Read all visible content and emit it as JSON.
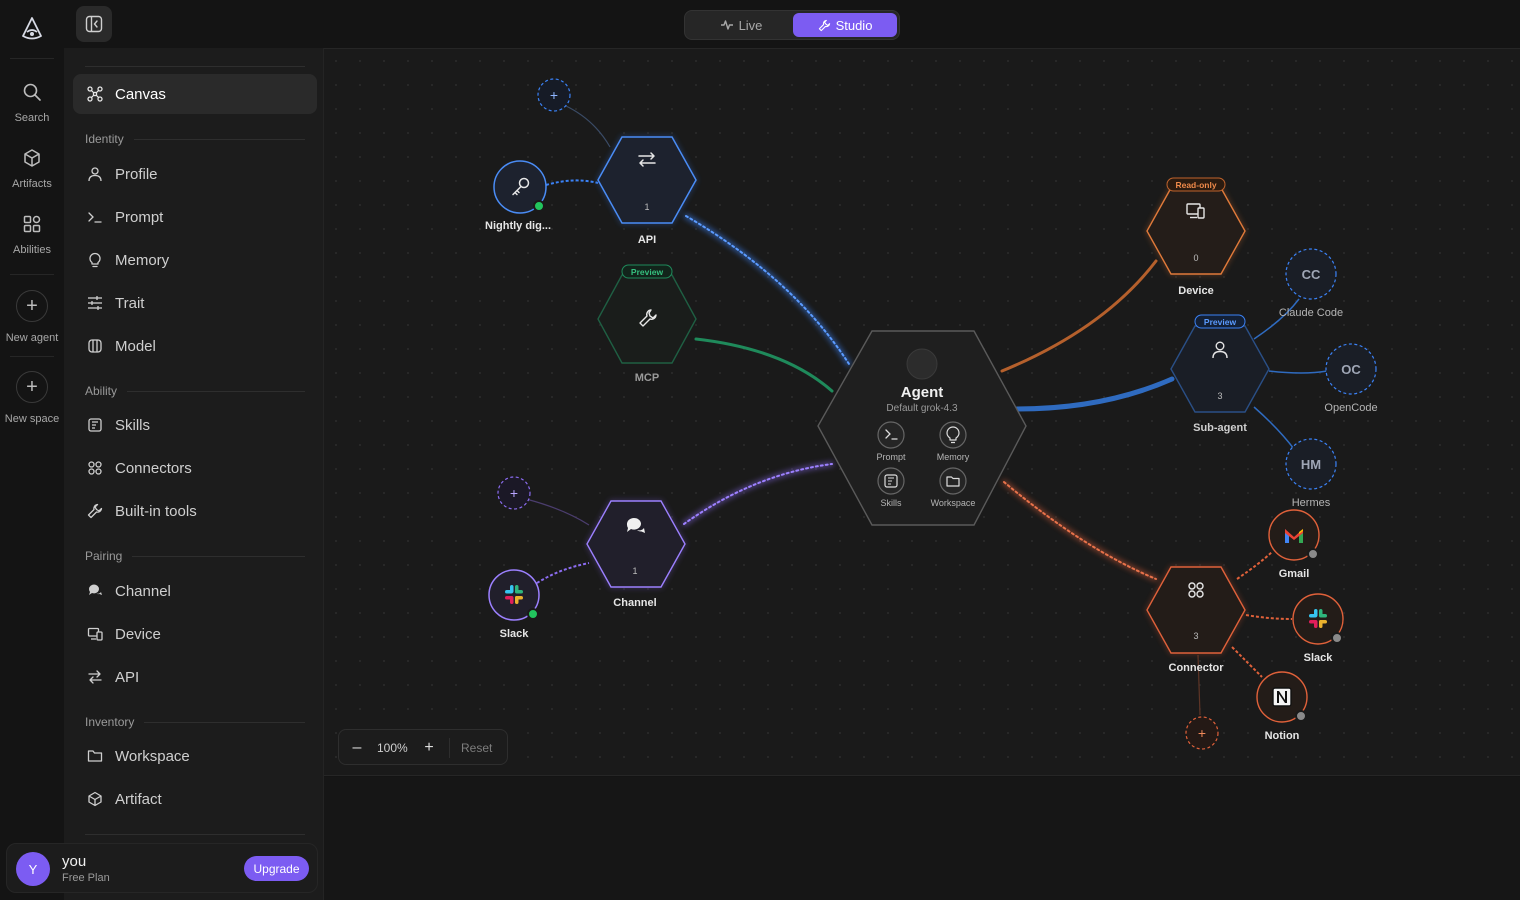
{
  "rail": {
    "items": [
      {
        "label": "Search",
        "icon": "search-icon"
      },
      {
        "label": "Artifacts",
        "icon": "cube-icon"
      },
      {
        "label": "Abilities",
        "icon": "grid-icon"
      },
      {
        "label": "New agent",
        "icon": "plus-icon"
      },
      {
        "label": "New space",
        "icon": "plus-icon"
      }
    ]
  },
  "mode": {
    "live": "Live",
    "studio": "Studio"
  },
  "sidebar": {
    "canvas": "Canvas",
    "sections": {
      "identity": "Identity",
      "ability": "Ability",
      "pairing": "Pairing",
      "inventory": "Inventory"
    },
    "identity": [
      "Profile",
      "Prompt",
      "Memory",
      "Trait",
      "Model"
    ],
    "ability": [
      "Skills",
      "Connectors",
      "Built-in tools"
    ],
    "pairing": [
      "Channel",
      "Device",
      "API"
    ],
    "inventory": [
      "Workspace",
      "Artifact"
    ]
  },
  "user": {
    "initial": "Y",
    "name": "you",
    "plan": "Free Plan",
    "upgrade": "Upgrade"
  },
  "zoom": {
    "minus": "–",
    "value": "100%",
    "plus": "+",
    "reset": "Reset"
  },
  "graph": {
    "agent": {
      "title": "Agent",
      "subtitle": "Default grok-4.3",
      "modules": [
        "Prompt",
        "Memory",
        "Skills",
        "Workspace"
      ]
    },
    "api": {
      "label": "API",
      "count": "1"
    },
    "mcp": {
      "label": "MCP",
      "badge": "Preview"
    },
    "channel": {
      "label": "Channel",
      "count": "1"
    },
    "device": {
      "label": "Device",
      "count": "0",
      "badge": "Read-only"
    },
    "subagent": {
      "label": "Sub-agent",
      "count": "3",
      "badge": "Preview"
    },
    "connector": {
      "label": "Connector",
      "count": "3"
    },
    "nightly": {
      "label": "Nightly dig..."
    },
    "slack_left": {
      "label": "Slack"
    },
    "cc": {
      "abbr": "CC",
      "label": "Claude Code"
    },
    "oc": {
      "abbr": "OC",
      "label": "OpenCode"
    },
    "hm": {
      "abbr": "HM",
      "label": "Hermes"
    },
    "gmail": {
      "label": "Gmail"
    },
    "slack_right": {
      "label": "Slack"
    },
    "notion": {
      "label": "Notion"
    },
    "add_symbol": "+"
  },
  "colors": {
    "accent": "#7c5cf2",
    "api_blue": "#3b82f6",
    "mcp_green": "#1f8a5b",
    "channel_purple": "#8b6cf0",
    "device_orange": "#e07a3a",
    "connector_orange": "#e0613a",
    "status_green": "#22c55e"
  }
}
